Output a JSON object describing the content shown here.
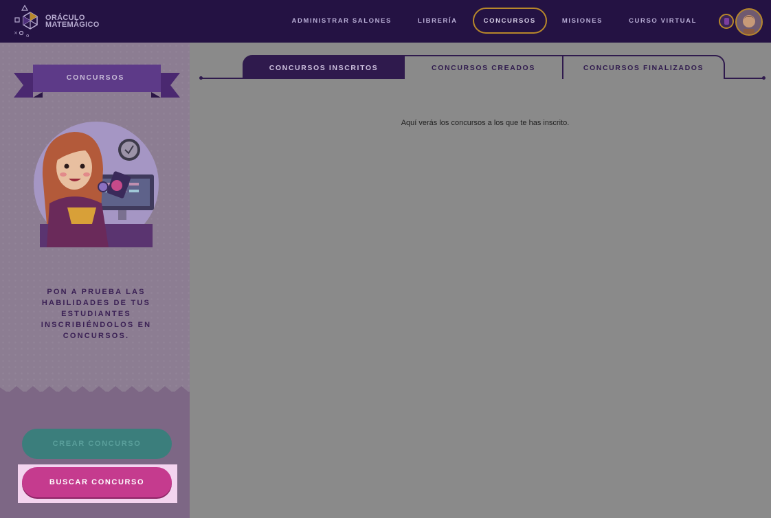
{
  "brand": {
    "line1": "ORÁCULO",
    "line2": "MATEMÁGICO"
  },
  "nav": {
    "items": [
      {
        "label": "ADMINISTRAR SALONES"
      },
      {
        "label": "LIBRERÍA"
      },
      {
        "label": "CONCURSOS"
      },
      {
        "label": "MISIONES"
      },
      {
        "label": "CURSO VIRTUAL"
      }
    ],
    "active": "CONCURSOS"
  },
  "sidebar": {
    "banner_title": "CONCURSOS",
    "tagline": "PON A PRUEBA LAS HABILIDADES DE TUS ESTUDIANTES INSCRIBIÉNDOLOS EN CONCURSOS.",
    "create_button": "CREAR CONCURSO",
    "search_button": "BUSCAR CONCURSO"
  },
  "tabs": [
    {
      "label": "CONCURSOS INSCRITOS"
    },
    {
      "label": "CONCURSOS CREADOS"
    },
    {
      "label": "CONCURSOS FINALIZADOS"
    }
  ],
  "main": {
    "empty_message": "Aquí verás los concursos a los que te has inscrito."
  },
  "colors": {
    "header": "#241243",
    "accent_gold": "#b8882a",
    "create_button": "#3b7e7c",
    "search_button": "#c53b8e",
    "dark_purple": "#2f1a4d"
  }
}
